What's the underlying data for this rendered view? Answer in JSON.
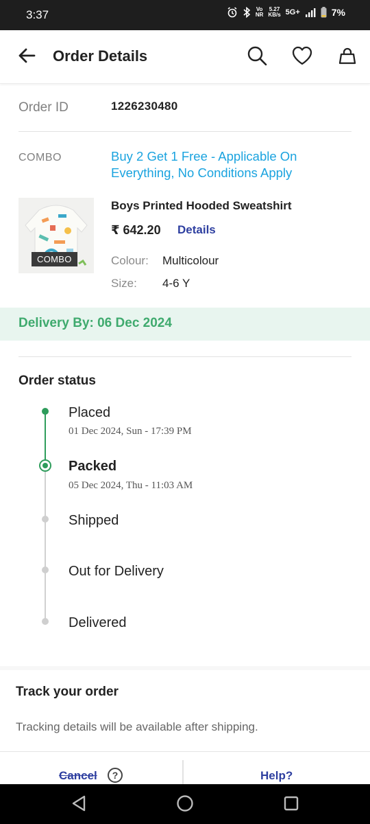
{
  "status_bar": {
    "time": "3:37",
    "volte": "Vo\nNR",
    "speed_value": "5.27",
    "speed_unit": "KB/s",
    "network": "5G+",
    "battery": "7%"
  },
  "header": {
    "title": "Order Details",
    "back_icon": "arrow-left-icon",
    "search_icon": "search-icon",
    "wishlist_icon": "heart-icon",
    "bag_icon": "bag-icon"
  },
  "order": {
    "id_label": "Order ID",
    "id_value": "1226230480"
  },
  "combo": {
    "label": "COMBO",
    "offer": "Buy 2 Get 1 Free - Applicable On Everything, No Conditions Apply"
  },
  "product": {
    "badge": "COMBO",
    "name": "Boys Printed Hooded Sweatshirt",
    "price": "₹ 642.20",
    "details_link": "Details",
    "colour_label": "Colour:",
    "colour_value": "Multicolour",
    "size_label": "Size:",
    "size_value": "4-6 Y"
  },
  "delivery": {
    "text": "Delivery By: 06 Dec 2024"
  },
  "order_status": {
    "title": "Order status",
    "steps": [
      {
        "name": "Placed",
        "time": "01 Dec 2024, Sun - 17:39 PM",
        "state": "done"
      },
      {
        "name": "Packed",
        "time": "05 Dec 2024, Thu - 11:03 AM",
        "state": "current"
      },
      {
        "name": "Shipped",
        "time": "",
        "state": "pending"
      },
      {
        "name": "Out for Delivery",
        "time": "",
        "state": "pending"
      },
      {
        "name": "Delivered",
        "time": "",
        "state": "pending"
      }
    ]
  },
  "tracking": {
    "title": "Track your order",
    "text": "Tracking details will be available after shipping."
  },
  "actions": {
    "cancel": "Cancel",
    "cancel_help": "?",
    "help": "Help?"
  },
  "colors": {
    "accent_blue": "#2e3fa0",
    "offer_blue": "#1aa3df",
    "success_green": "#2e9c5b",
    "delivery_bg": "#e8f5ef"
  },
  "nav_bar": {
    "back": "triangle-back-icon",
    "home": "circle-home-icon",
    "recents": "square-recents-icon"
  }
}
